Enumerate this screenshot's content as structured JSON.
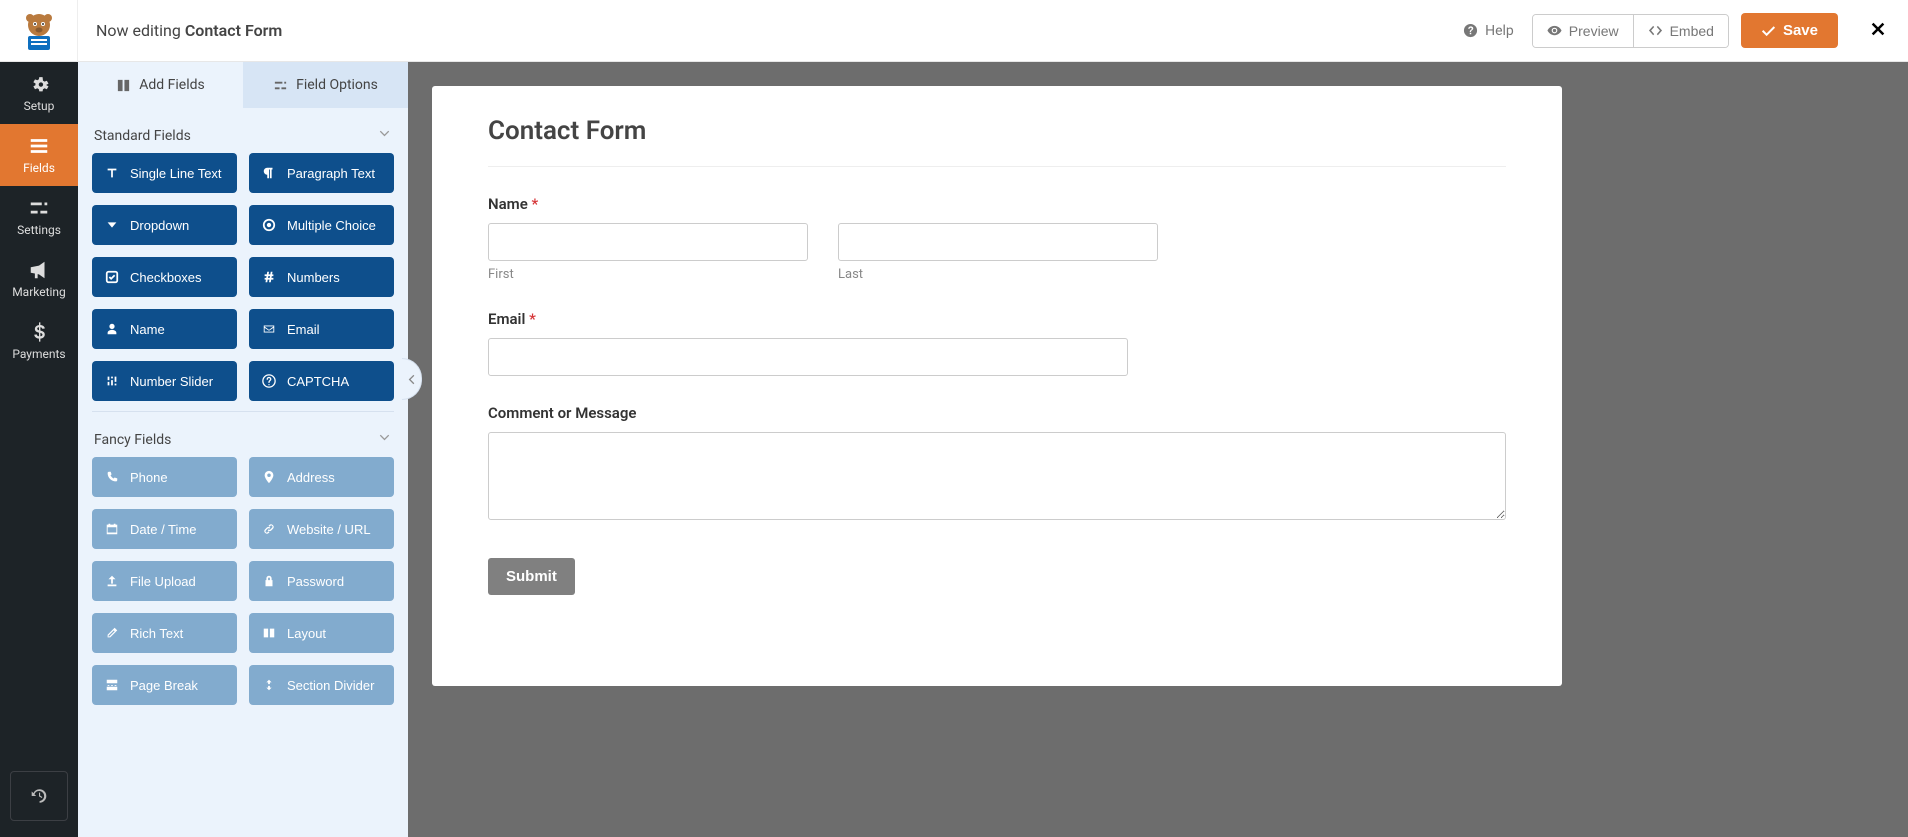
{
  "topbar": {
    "editing_prefix": "Now editing ",
    "form_name": "Contact Form",
    "help": "Help",
    "preview": "Preview",
    "embed": "Embed",
    "save": "Save"
  },
  "nav": {
    "setup": "Setup",
    "fields": "Fields",
    "settings": "Settings",
    "marketing": "Marketing",
    "payments": "Payments"
  },
  "panel": {
    "tab_add": "Add Fields",
    "tab_options": "Field Options",
    "section_standard": "Standard Fields",
    "section_fancy": "Fancy Fields",
    "standard": [
      {
        "label": "Single Line Text",
        "icon": "text"
      },
      {
        "label": "Paragraph Text",
        "icon": "paragraph"
      },
      {
        "label": "Dropdown",
        "icon": "caret"
      },
      {
        "label": "Multiple Choice",
        "icon": "radio"
      },
      {
        "label": "Checkboxes",
        "icon": "check"
      },
      {
        "label": "Numbers",
        "icon": "hash"
      },
      {
        "label": "Name",
        "icon": "user"
      },
      {
        "label": "Email",
        "icon": "mail"
      },
      {
        "label": "Number Slider",
        "icon": "sliders"
      },
      {
        "label": "CAPTCHA",
        "icon": "question"
      }
    ],
    "fancy": [
      {
        "label": "Phone",
        "icon": "phone"
      },
      {
        "label": "Address",
        "icon": "pin"
      },
      {
        "label": "Date / Time",
        "icon": "calendar"
      },
      {
        "label": "Website / URL",
        "icon": "link"
      },
      {
        "label": "File Upload",
        "icon": "upload"
      },
      {
        "label": "Password",
        "icon": "lock"
      },
      {
        "label": "Rich Text",
        "icon": "edit"
      },
      {
        "label": "Layout",
        "icon": "columns"
      },
      {
        "label": "Page Break",
        "icon": "pagebreak"
      },
      {
        "label": "Section Divider",
        "icon": "arrows"
      }
    ]
  },
  "form": {
    "title": "Contact Form",
    "name_label": "Name",
    "name_required": "*",
    "first_sub": "First",
    "last_sub": "Last",
    "email_label": "Email",
    "email_required": "*",
    "comment_label": "Comment or Message",
    "submit": "Submit"
  }
}
